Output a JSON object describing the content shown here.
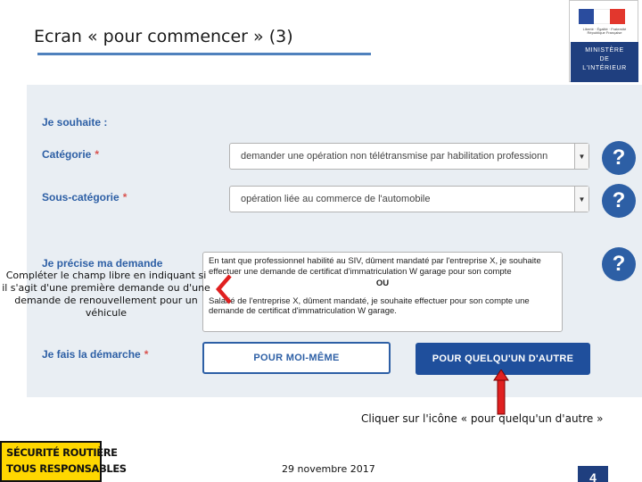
{
  "slide": {
    "title": "Ecran « pour commencer » (3)",
    "date": "29 novembre 2017",
    "page_number": "4"
  },
  "logo_ministry": {
    "tagline": "Liberté · Égalité · Fraternité  République Française",
    "ministry_line1": "MINISTÈRE",
    "ministry_line2": "DE",
    "ministry_line3": "L'INTÉRIEUR",
    "flag_colors": [
      "#2a4c9e",
      "#ffffff",
      "#e2372d"
    ]
  },
  "logo_road_safety": {
    "line1": "SÉCURITÉ ROUTIÈRE",
    "line2": "TOUS RESPONSABLES",
    "bg_color": "#ffd700"
  },
  "form": {
    "heading_wish": "Je souhaite :",
    "category_label": "Catégorie",
    "category_value": "demander une opération non télétransmise par habilitation professionn",
    "subcategory_label": "Sous-catégorie",
    "subcategory_value": "opération liée au commerce de l'automobile",
    "details_label": "Je précise ma demande",
    "details_text_1": "En tant que professionnel habilité au SIV, dûment mandaté par l'entreprise X, je souhaite effectuer une demande de certificat d'immatriculation W garage pour son compte",
    "details_or": "OU",
    "details_text_2": "Salarié de l'entreprise X, dûment mandaté, je souhaite effectuer pour son compte une demande de certificat d'immatriculation W garage.",
    "approach_label": "Je fais la démarche",
    "required_marker": "*",
    "btn_self": "POUR MOI-MÊME",
    "btn_other": "POUR QUELQU'UN D'AUTRE",
    "help_glyph": "?",
    "dropdown_glyph": "▼",
    "accent_color": "#2d5fa5",
    "required_color": "#d9534f"
  },
  "annotations": {
    "left_callout": "Compléter le champ libre en indiquant si il s'agit d'une première demande ou d'une demande de renouvellement pour un véhicule",
    "right_callout": "Cliquer sur l'icône « pour quelqu'un d'autre »",
    "arrow_color": "#e02020",
    "left_marker_icon": "chevron-left-icon",
    "bottom_marker_icon": "arrow-up-icon"
  }
}
